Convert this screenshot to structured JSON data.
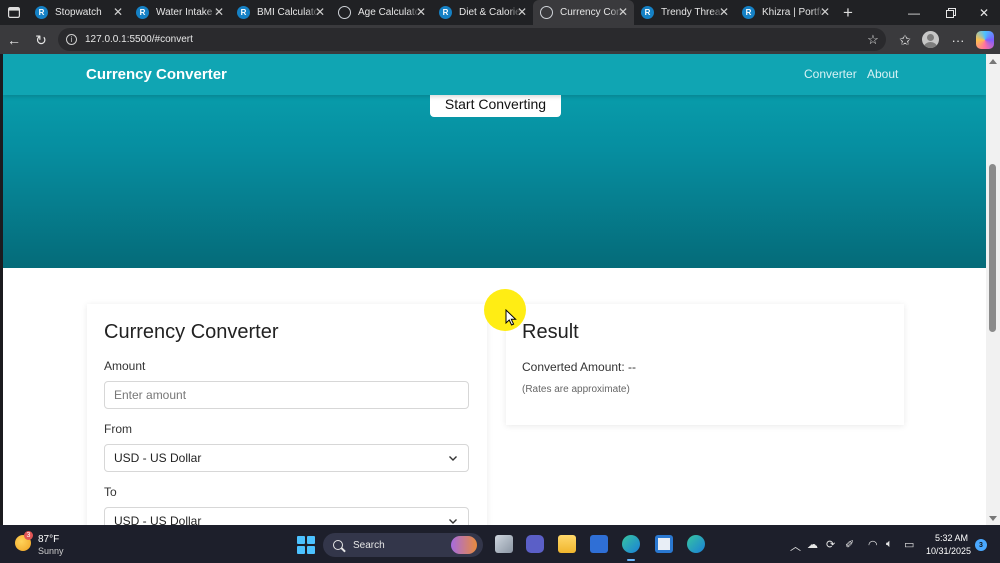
{
  "browser": {
    "tabs": [
      {
        "label": "Stopwatch",
        "icon": "replit-favicon-icon",
        "active": false
      },
      {
        "label": "Water Intake C",
        "icon": "replit-favicon-icon",
        "active": false
      },
      {
        "label": "BMI Calculator",
        "icon": "replit-favicon-icon",
        "active": false
      },
      {
        "label": "Age Calculator",
        "icon": "globe-icon",
        "active": false
      },
      {
        "label": "Diet & Calorie",
        "icon": "replit-favicon-icon",
        "active": false
      },
      {
        "label": "Currency Conv",
        "icon": "globe-icon",
        "active": true
      },
      {
        "label": "Trendy Thread",
        "icon": "replit-favicon-icon",
        "active": false
      },
      {
        "label": "Khizra | Portfo",
        "icon": "replit-favicon-icon",
        "active": false
      }
    ],
    "favicon_letter": "R",
    "url": "127.0.0.1:5500/#convert"
  },
  "page": {
    "brand": "Currency Converter",
    "nav_links": [
      "Converter",
      "About"
    ],
    "hero_button": "Start Converting",
    "converter": {
      "title": "Currency Converter",
      "amount_label": "Amount",
      "amount_placeholder": "Enter amount",
      "from_label": "From",
      "from_value": "USD - US Dollar",
      "to_label": "To",
      "to_value": "USD - US Dollar"
    },
    "result": {
      "title": "Result",
      "converted_line": "Converted Amount: --",
      "note": "(Rates are approximate)"
    }
  },
  "taskbar": {
    "weather_temp": "87°F",
    "weather_condition": "Sunny",
    "weather_badge": "3",
    "search_label": "Search",
    "time": "5:32 AM",
    "date": "10/31/2025",
    "notification_count": "3"
  },
  "colors": {
    "hero_accent": "#0aa6b2",
    "navbar": "#10a5b3"
  }
}
